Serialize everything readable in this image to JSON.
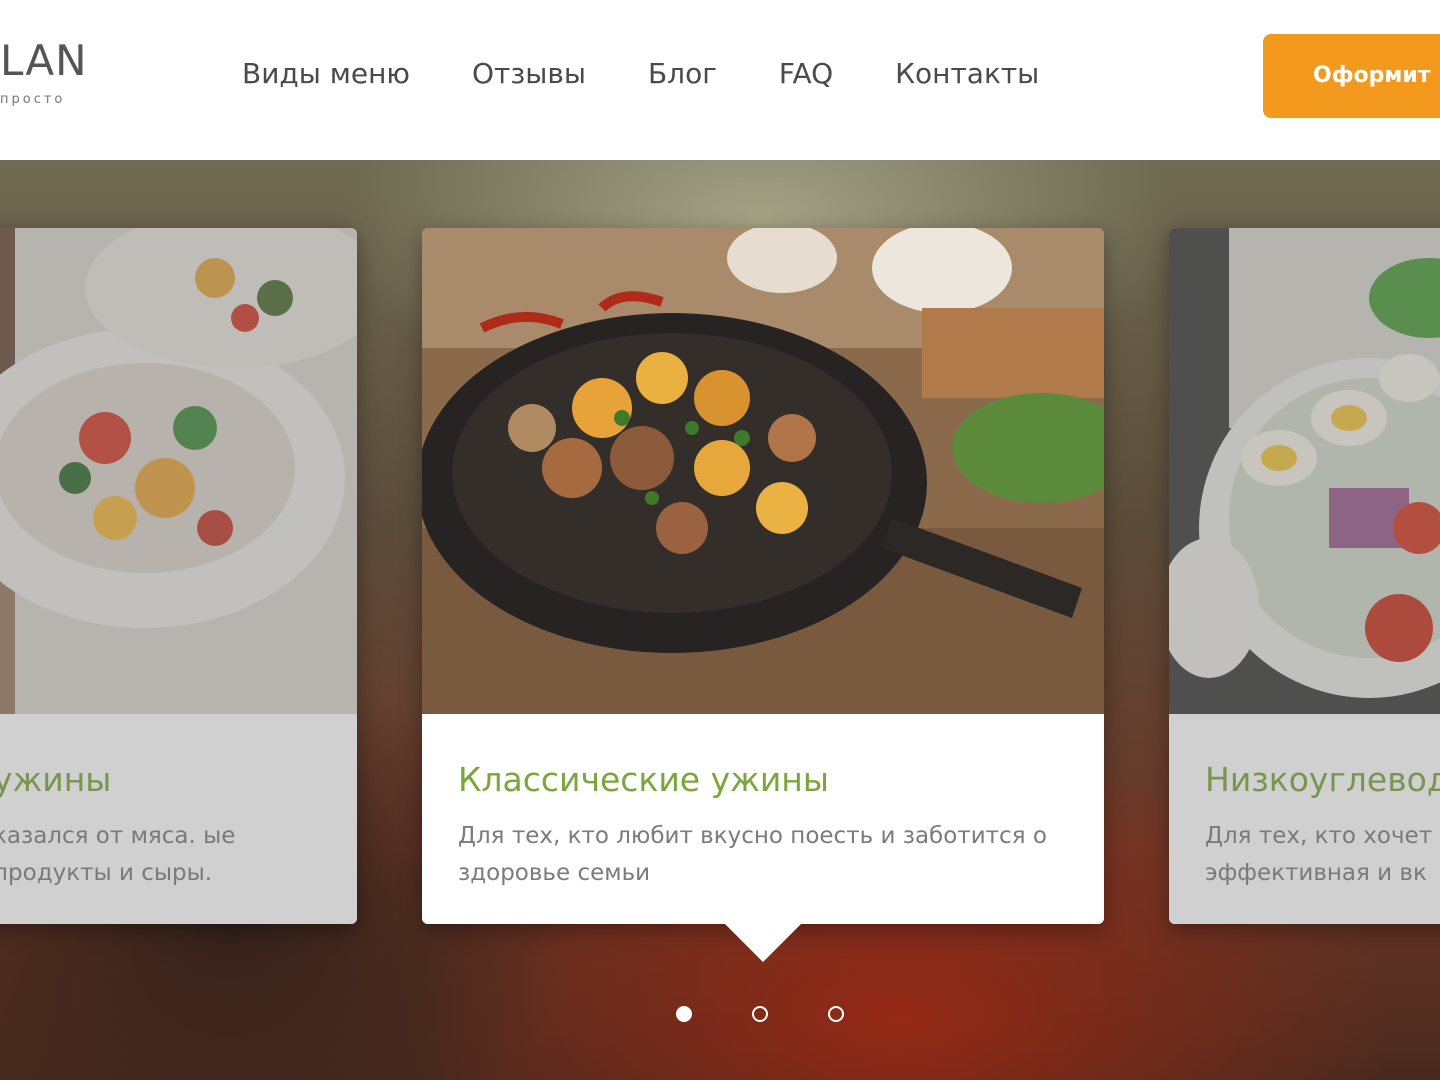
{
  "brand": {
    "name": "LAN",
    "tagline": "просто"
  },
  "nav": [
    {
      "label": "Виды меню"
    },
    {
      "label": "Отзывы"
    },
    {
      "label": "Блог"
    },
    {
      "label": "FAQ"
    },
    {
      "label": "Контакты"
    }
  ],
  "cta": {
    "label": "Оформит"
  },
  "slides": [
    {
      "title": "ужины",
      "desc": "казался от мяса. ые продукты и сыры."
    },
    {
      "title": "Классические ужины",
      "desc": "Для тех, кто любит вкусно поесть и заботится о здоровье семьи"
    },
    {
      "title": "Низкоуглевод",
      "desc": "Для тех, кто хочет эффективная и вк"
    }
  ],
  "carousel": {
    "active_index": 1,
    "total": 3
  },
  "colors": {
    "accent": "#f39a1e",
    "title_green": "#7aa63b",
    "text_gray": "#7b7b7b"
  }
}
